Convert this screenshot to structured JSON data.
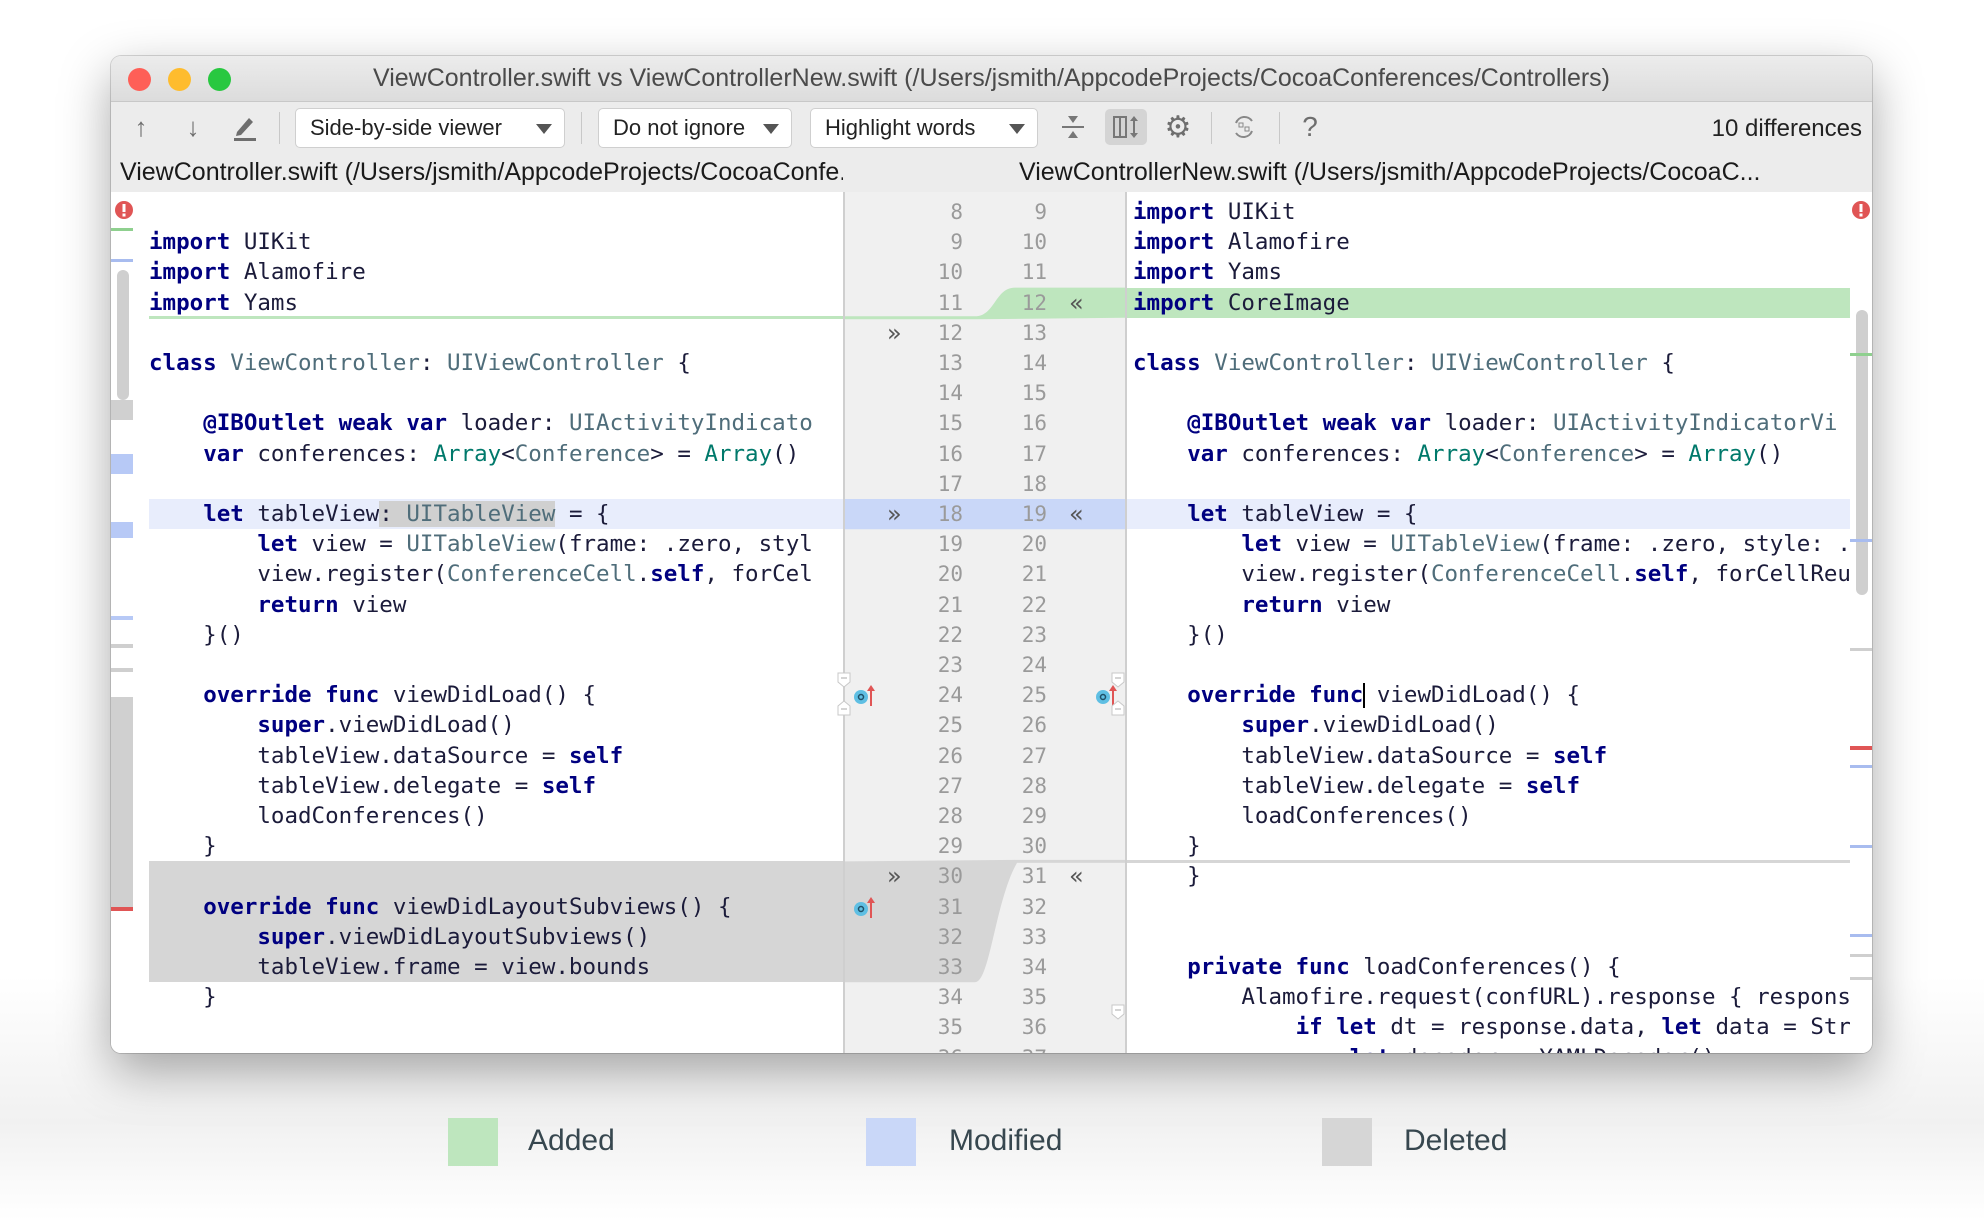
{
  "window": {
    "title": "ViewController.swift vs ViewControllerNew.swift (/Users/jsmith/AppcodeProjects/CocoaConferences/Controllers)"
  },
  "toolbar": {
    "prev_icon": "arrow-up-icon",
    "next_icon": "arrow-down-icon",
    "edit_icon": "pencil-icon",
    "viewer_mode": "Side-by-side viewer",
    "ignore_mode": "Do not ignore",
    "highlight_mode": "Highlight words",
    "collapse_icon": "collapse-unchanged-icon",
    "sync_scroll_icon": "synchronize-scrolling-icon",
    "settings_icon": "gear-icon",
    "swap_icon": "swap-sides-icon",
    "help_label": "?",
    "differences": "10 differences"
  },
  "left_file": {
    "header": "ViewController.swift (/Users/jsmith/AppcodeProjects/CocoaConfe...",
    "first_line": 8,
    "lines": [
      [],
      [
        [
          "kw",
          "import"
        ],
        [
          "pl",
          " UIKit"
        ]
      ],
      [
        [
          "kw",
          "import"
        ],
        [
          "pl",
          " Alamofire"
        ]
      ],
      [
        [
          "kw",
          "import"
        ],
        [
          "pl",
          " Yams"
        ]
      ],
      [],
      [
        [
          "kw",
          "class"
        ],
        [
          "pl",
          " "
        ],
        [
          "ty",
          "ViewController"
        ],
        [
          "pl",
          ": "
        ],
        [
          "ty",
          "UIViewController"
        ],
        [
          "pl",
          " {"
        ]
      ],
      [],
      [
        [
          "pl",
          "    "
        ],
        [
          "kw",
          "@IBOutlet weak var"
        ],
        [
          "pl",
          " loader: "
        ],
        [
          "ty",
          "UIActivityIndicato"
        ]
      ],
      [
        [
          "pl",
          "    "
        ],
        [
          "kw",
          "var"
        ],
        [
          "pl",
          " conferences: "
        ],
        [
          "gn",
          "Array"
        ],
        [
          "pl",
          "<"
        ],
        [
          "ty",
          "Conference"
        ],
        [
          "pl",
          "> = "
        ],
        [
          "gn",
          "Array"
        ],
        [
          "pl",
          "()"
        ]
      ],
      [],
      [
        [
          "pl",
          "    "
        ],
        [
          "kw",
          "let"
        ],
        [
          "pl",
          " tableView"
        ],
        [
          "hl",
          ": "
        ],
        [
          "hlty",
          "UITableView"
        ],
        [
          "pl",
          " = {"
        ]
      ],
      [
        [
          "pl",
          "        "
        ],
        [
          "kw",
          "let"
        ],
        [
          "pl",
          " view = "
        ],
        [
          "ty",
          "UITableView"
        ],
        [
          "pl",
          "(frame: .zero, styl"
        ]
      ],
      [
        [
          "pl",
          "        view.register("
        ],
        [
          "ty",
          "ConferenceCell"
        ],
        [
          "pl",
          "."
        ],
        [
          "kw",
          "self"
        ],
        [
          "pl",
          ", forCel"
        ]
      ],
      [
        [
          "pl",
          "        "
        ],
        [
          "kw",
          "return"
        ],
        [
          "pl",
          " view"
        ]
      ],
      [
        [
          "pl",
          "    }()"
        ]
      ],
      [],
      [
        [
          "pl",
          "    "
        ],
        [
          "kw",
          "override func"
        ],
        [
          "pl",
          " viewDidLoad() {"
        ]
      ],
      [
        [
          "pl",
          "        "
        ],
        [
          "kw",
          "super"
        ],
        [
          "pl",
          ".viewDidLoad()"
        ]
      ],
      [
        [
          "pl",
          "        tableView.dataSource = "
        ],
        [
          "kw",
          "self"
        ]
      ],
      [
        [
          "pl",
          "        tableView.delegate = "
        ],
        [
          "kw",
          "self"
        ]
      ],
      [
        [
          "pl",
          "        loadConferences()"
        ]
      ],
      [
        [
          "pl",
          "    }"
        ]
      ],
      [],
      [
        [
          "pl",
          "    "
        ],
        [
          "kw",
          "override func"
        ],
        [
          "pl",
          " viewDidLayoutSubviews() {"
        ]
      ],
      [
        [
          "pl",
          "        "
        ],
        [
          "kw",
          "super"
        ],
        [
          "pl",
          ".viewDidLayoutSubviews()"
        ]
      ],
      [
        [
          "pl",
          "        tableView.frame = view.bounds"
        ]
      ],
      [
        [
          "pl",
          "    }"
        ]
      ],
      [],
      []
    ]
  },
  "right_file": {
    "header": "ViewControllerNew.swift (/Users/jsmith/AppcodeProjects/CocoaC...",
    "first_line": 9,
    "lines": [
      [
        [
          "kw",
          "import"
        ],
        [
          "pl",
          " UIKit"
        ]
      ],
      [
        [
          "kw",
          "import"
        ],
        [
          "pl",
          " Alamofire"
        ]
      ],
      [
        [
          "kw",
          "import"
        ],
        [
          "pl",
          " Yams"
        ]
      ],
      [
        [
          "kw",
          "import"
        ],
        [
          "pl",
          " CoreImage"
        ]
      ],
      [],
      [
        [
          "kw",
          "class"
        ],
        [
          "pl",
          " "
        ],
        [
          "ty",
          "ViewController"
        ],
        [
          "pl",
          ": "
        ],
        [
          "ty",
          "UIViewController"
        ],
        [
          "pl",
          " {"
        ]
      ],
      [],
      [
        [
          "pl",
          "    "
        ],
        [
          "kw",
          "@IBOutlet weak var"
        ],
        [
          "pl",
          " loader: "
        ],
        [
          "ty",
          "UIActivityIndicatorVi"
        ]
      ],
      [
        [
          "pl",
          "    "
        ],
        [
          "kw",
          "var"
        ],
        [
          "pl",
          " conferences: "
        ],
        [
          "gn",
          "Array"
        ],
        [
          "pl",
          "<"
        ],
        [
          "ty",
          "Conference"
        ],
        [
          "pl",
          "> = "
        ],
        [
          "gn",
          "Array"
        ],
        [
          "pl",
          "()"
        ]
      ],
      [],
      [
        [
          "pl",
          "    "
        ],
        [
          "kw",
          "let"
        ],
        [
          "pl",
          " tableView = {"
        ]
      ],
      [
        [
          "pl",
          "        "
        ],
        [
          "kw",
          "let"
        ],
        [
          "pl",
          " view = "
        ],
        [
          "ty",
          "UITableView"
        ],
        [
          "pl",
          "(frame: .zero, style: ."
        ]
      ],
      [
        [
          "pl",
          "        view.register("
        ],
        [
          "ty",
          "ConferenceCell"
        ],
        [
          "pl",
          "."
        ],
        [
          "kw",
          "self"
        ],
        [
          "pl",
          ", forCellReu"
        ]
      ],
      [
        [
          "pl",
          "        "
        ],
        [
          "kw",
          "return"
        ],
        [
          "pl",
          " view"
        ]
      ],
      [
        [
          "pl",
          "    }()"
        ]
      ],
      [],
      [
        [
          "pl",
          "    "
        ],
        [
          "kw",
          "override func"
        ],
        [
          "pl",
          " viewDidLoad() {"
        ]
      ],
      [
        [
          "pl",
          "        "
        ],
        [
          "kw",
          "super"
        ],
        [
          "pl",
          ".viewDidLoad()"
        ]
      ],
      [
        [
          "pl",
          "        tableView.dataSource = "
        ],
        [
          "kw",
          "self"
        ]
      ],
      [
        [
          "pl",
          "        tableView.delegate = "
        ],
        [
          "kw",
          "self"
        ]
      ],
      [
        [
          "pl",
          "        loadConferences()"
        ]
      ],
      [
        [
          "pl",
          "    }"
        ]
      ],
      [
        [
          "pl",
          "    }"
        ]
      ],
      [],
      [],
      [
        [
          "pl",
          "    "
        ],
        [
          "kw",
          "private func"
        ],
        [
          "pl",
          " loadConferences() {"
        ]
      ],
      [
        [
          "pl",
          "        Alamofire.request(confURL).response { respons"
        ]
      ],
      [
        [
          "pl",
          "            "
        ],
        [
          "kw",
          "if let"
        ],
        [
          "pl",
          " dt = response.data, "
        ],
        [
          "kw",
          "let"
        ],
        [
          "pl",
          " data = Str"
        ]
      ],
      [
        [
          "pl",
          "                "
        ],
        [
          "kw",
          "let"
        ],
        [
          "pl",
          " decoder = YAMLDecoder()"
        ]
      ]
    ]
  },
  "legend": {
    "added": "Added",
    "modified": "Modified",
    "deleted": "Deleted"
  },
  "colors": {
    "added": "#bee6be",
    "modified": "#c9d7f8",
    "modified_line": "#e8edfc",
    "deleted": "#d6d6d6",
    "keyword": "#000080",
    "error": "#e05555"
  }
}
